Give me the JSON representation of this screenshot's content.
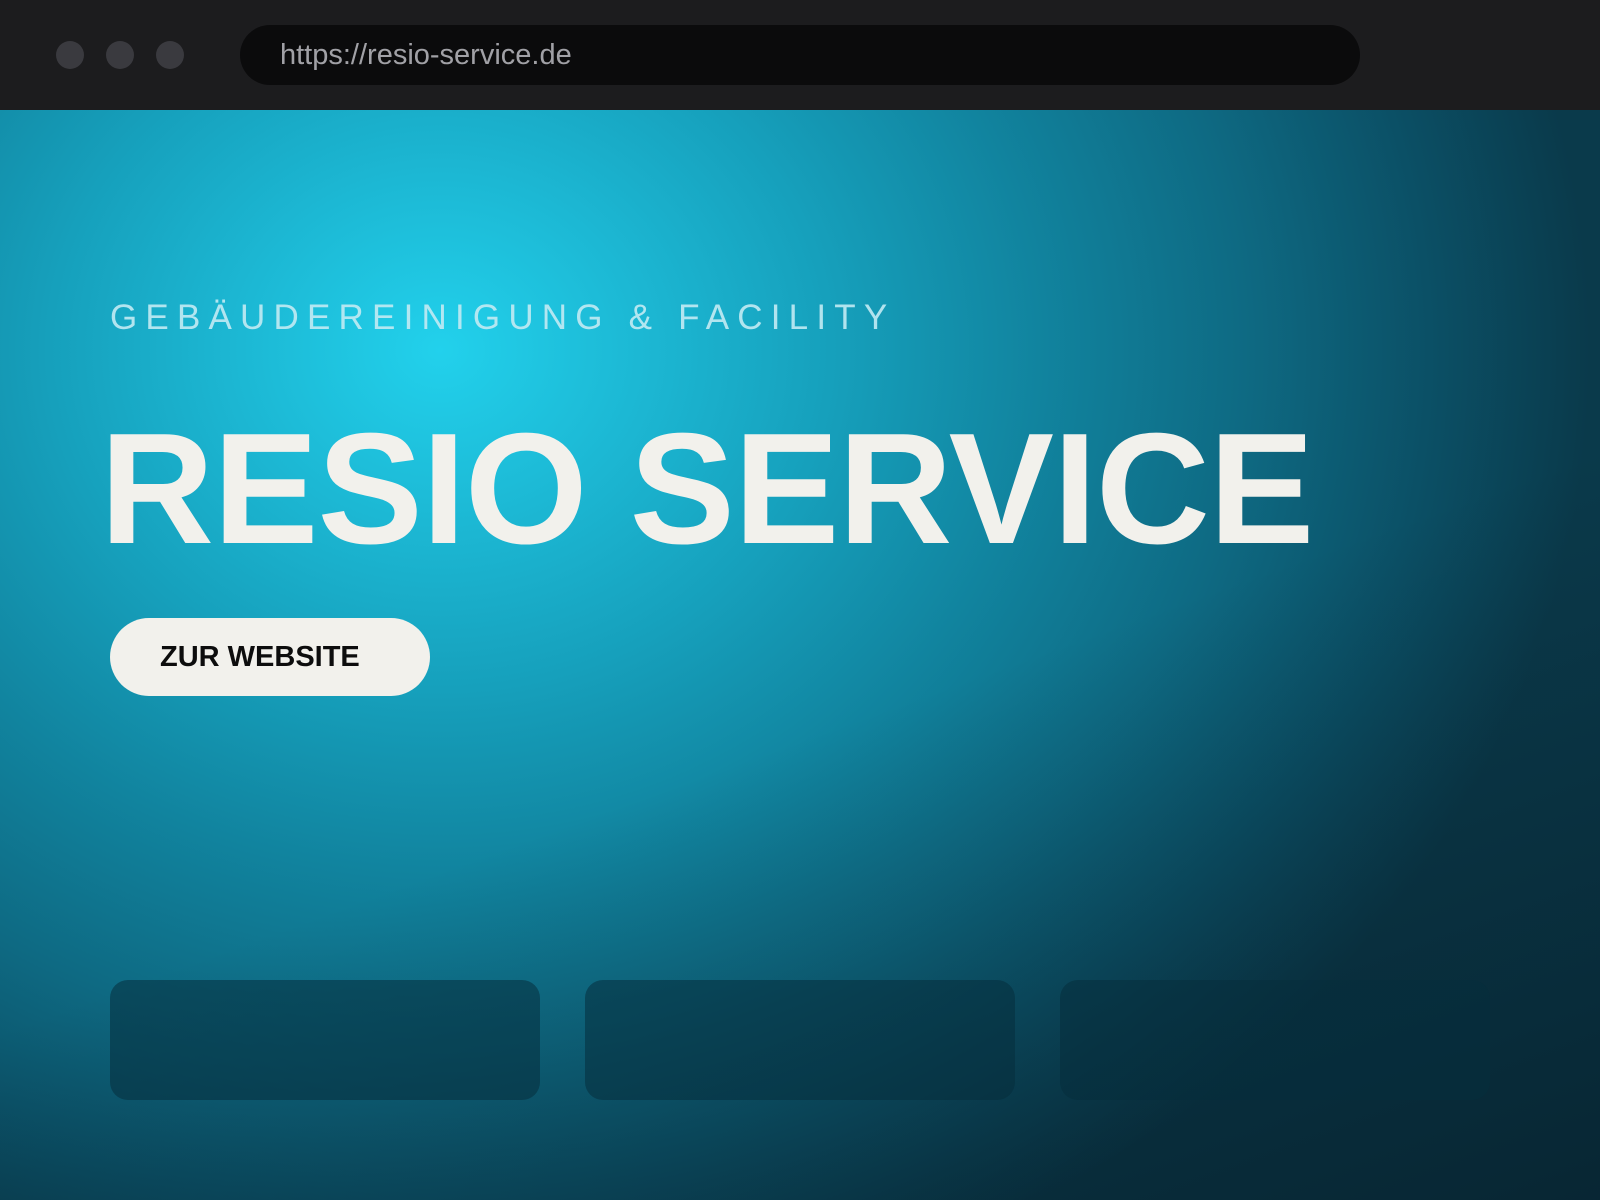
{
  "browser": {
    "url": "https://resio-service.de",
    "window_controls": [
      "close-dot",
      "minimize-dot",
      "zoom-dot"
    ]
  },
  "hero": {
    "eyebrow": "GEBÄUDEREINIGUNG & FACILITY",
    "title": "RESIO SERVICE",
    "cta_label": "ZUR WEBSITE"
  },
  "cards": [
    {
      "label": ""
    },
    {
      "label": ""
    },
    {
      "label": ""
    }
  ],
  "colors": {
    "accent_cyan": "#22d1ec",
    "deep_teal": "#0a3a4b",
    "light_text": "#f2f1ec",
    "chrome_bg": "#1c1c1e"
  }
}
